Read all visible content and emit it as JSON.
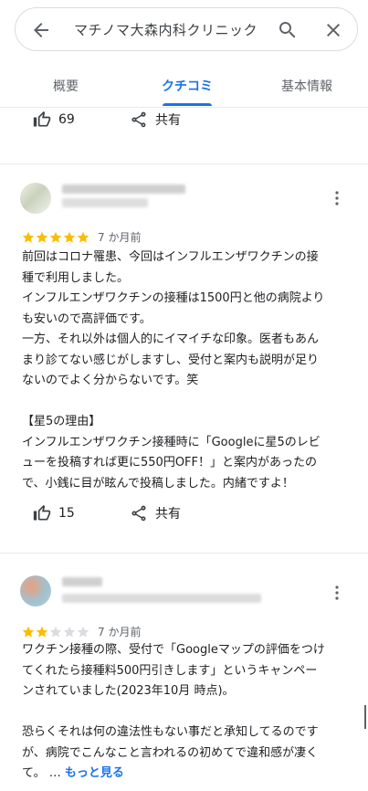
{
  "search": {
    "query": "マチノマ大森内科クリニック"
  },
  "tabs": [
    {
      "label": "概要"
    },
    {
      "label": "クチコミ"
    },
    {
      "label": "基本情報"
    }
  ],
  "top_actions": {
    "like_count": "69",
    "share_label": "共有"
  },
  "reviews": [
    {
      "rating": 5,
      "time": "7 か月前",
      "text": "前回はコロナ罹患、今回はインフルエンザワクチンの接\n種で利用しました。\nインフルエンザワクチンの接種は1500円と他の病院より\nも安いので高評価です。\n一方、それ以外は個人的にイマイチな印象。医者もあん\nまり診てない感じがしますし、受付と案内も説明が足り\nないのでよく分からないです。笑\n\n【星5の理由】\nインフルエンザワクチン接種時に「Googleに星5のレビ\nューを投稿すれば更に550円OFF！」と案内があったの\nで、小銭に目が眩んで投稿しました。内緒ですよ！",
      "like_count": "15",
      "share_label": "共有"
    },
    {
      "rating": 2,
      "time": "7 か月前",
      "text": "ワクチン接種の際、受付で「Googleマップの評価をつけ\nてくれたら接種料500円引きします」というキャンペー\nンされていました(2023年10月 時点)。\n\n恐らくそれは何の違法性もない事だと承知してるのです\nが、病院でこんなこと言われるの初めてで違和感が凄く\nて。 … ",
      "more_label": "もっと見る"
    }
  ],
  "colors": {
    "accent": "#1a73e8",
    "star": "#fbbc04",
    "star_empty": "#dadce0"
  }
}
